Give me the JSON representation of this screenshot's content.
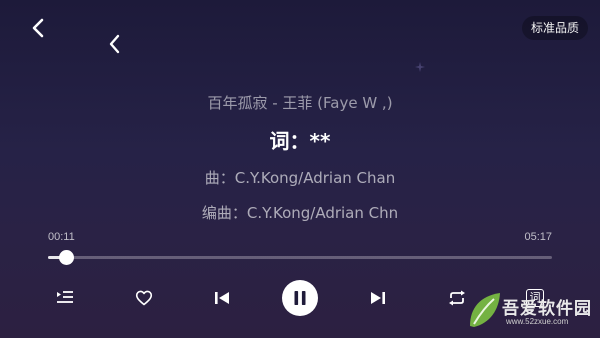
{
  "header": {
    "back_icon": "chevron-left-icon",
    "quality_label": "标准品质"
  },
  "lyrics": {
    "title_line": "百年孤寂 - 王菲 (Faye W     ,)",
    "current_line": "词：**",
    "composer_line": "曲：C.Y.Kong/Adrian Chan",
    "arranger_line": "编曲：C.Y.Kong/Adrian Chn"
  },
  "progress": {
    "elapsed": "00:11",
    "total": "05:17",
    "fraction": 0.035
  },
  "controls": {
    "playlist_icon": "playlist-icon",
    "like_icon": "heart-icon",
    "prev_icon": "skip-previous-icon",
    "play_icon": "pause-icon",
    "next_icon": "skip-next-icon",
    "repeat_icon": "repeat-icon",
    "lyric_toggle_label": "词"
  },
  "watermark": {
    "name": "吾爱软件园",
    "url": "www.52zxue.com"
  },
  "colors": {
    "background_top": "#1d1a3a",
    "background_bottom": "#2c2041",
    "accent": "#ffffff"
  }
}
